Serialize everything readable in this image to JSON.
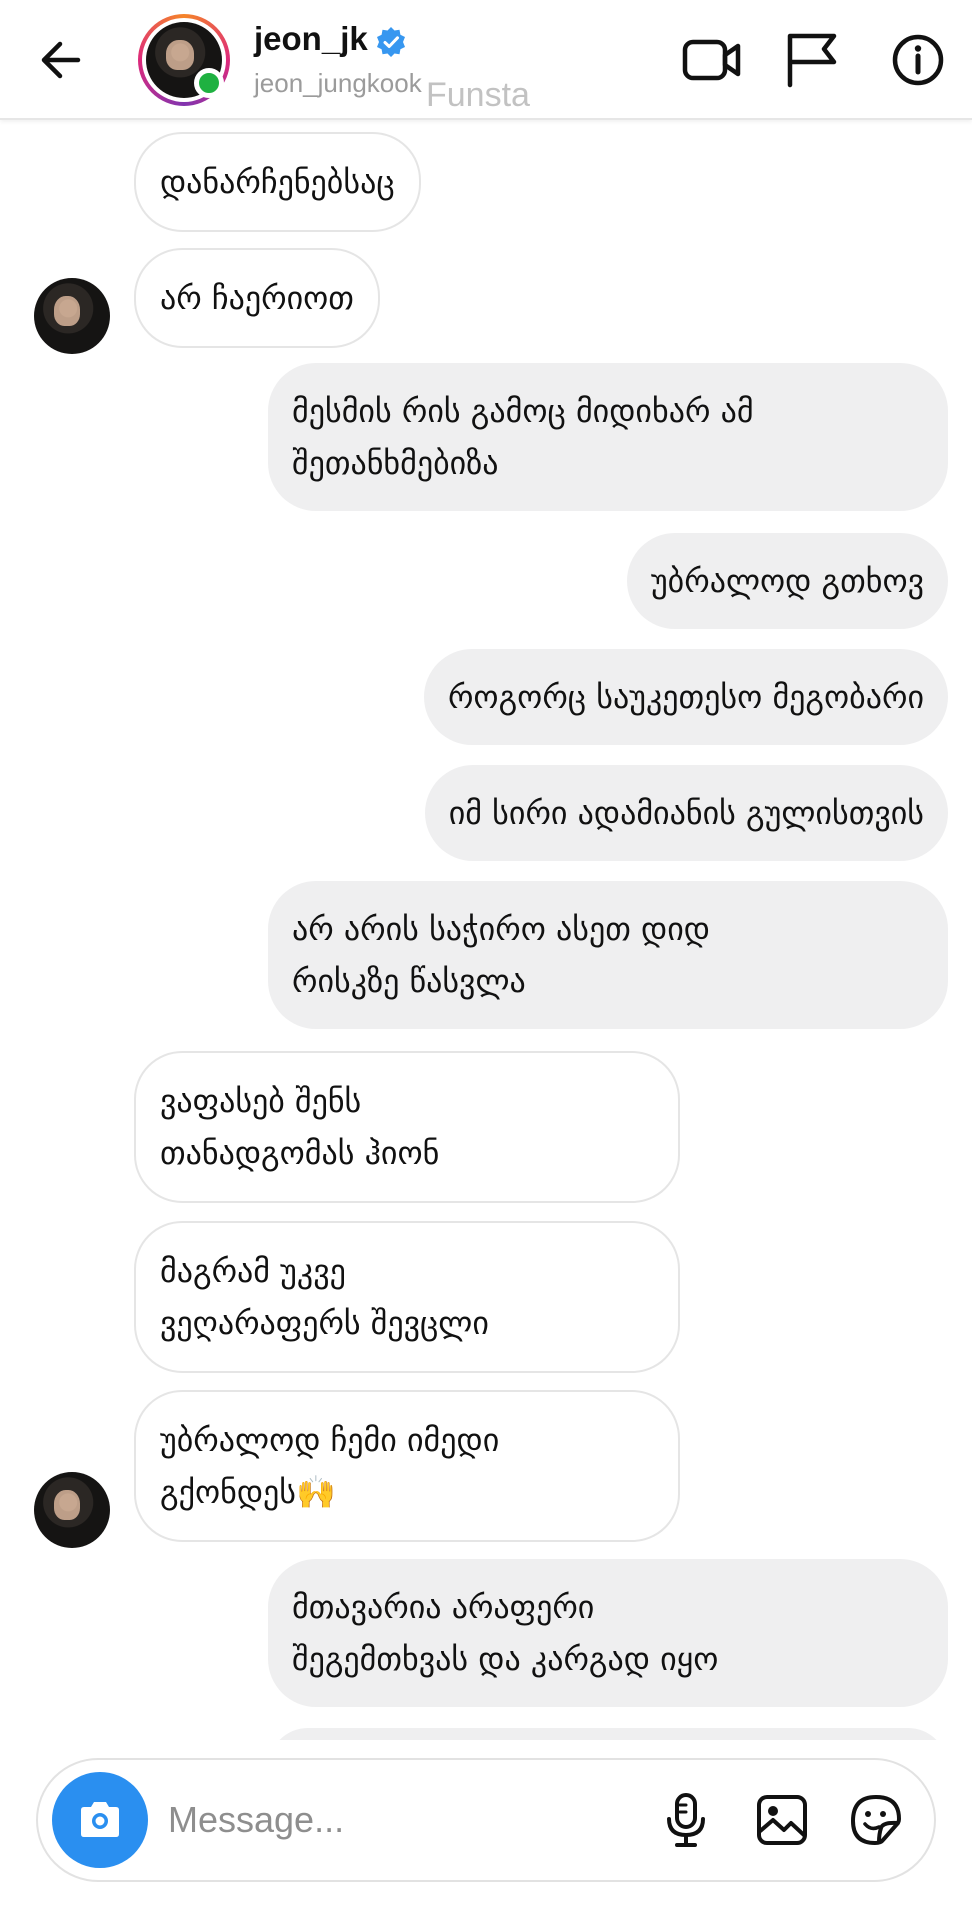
{
  "header": {
    "username": "jeon_jk",
    "handle": "jeon_jungkook",
    "watermark": "Funsta",
    "icons": {
      "back": "arrow-left-icon",
      "video": "video-camera-icon",
      "flag": "flag-icon",
      "info": "info-icon",
      "verified": "verified-badge-icon"
    },
    "online": true
  },
  "messages": [
    {
      "direction": "in",
      "text": "დანარჩენებსაც"
    },
    {
      "direction": "in",
      "text": "არ ჩაერიოთ"
    },
    {
      "direction": "out",
      "text": "მესმის რის გამოც მიდიხარ ამ\nშეთანხმებიზა"
    },
    {
      "direction": "out",
      "text": "უბრალოდ გთხოვ"
    },
    {
      "direction": "out",
      "text": "როგორც საუკეთესო მეგობარი"
    },
    {
      "direction": "out",
      "text": "იმ სირი ადამიანის გულისთვის"
    },
    {
      "direction": "out",
      "text": "არ არის საჭირო ასეთ დიდ\nრისკზე წასვლა"
    },
    {
      "direction": "in",
      "text": "ვაფასებ შენს\nთანადგომას ჰიონ"
    },
    {
      "direction": "in",
      "text": "მაგრამ უკვე\nვეღარაფერს შევცლი"
    },
    {
      "direction": "in",
      "text": "უბრალოდ ჩემი იმედი\nგქონდეს🙌"
    },
    {
      "direction": "out",
      "text": "მთავარია არაფერი\nშეგემთხვას და კარგად იყო"
    }
  ],
  "composer": {
    "placeholder": "Message...",
    "icons": {
      "camera": "camera-icon",
      "mic": "microphone-icon",
      "gallery": "gallery-icon",
      "sticker": "sticker-icon"
    }
  },
  "colors": {
    "accent": "#2a8ff0",
    "online": "#1fb141",
    "verified": "#3797f0",
    "outgoing_bubble": "#efeff0",
    "incoming_border": "#e5e5e5"
  }
}
